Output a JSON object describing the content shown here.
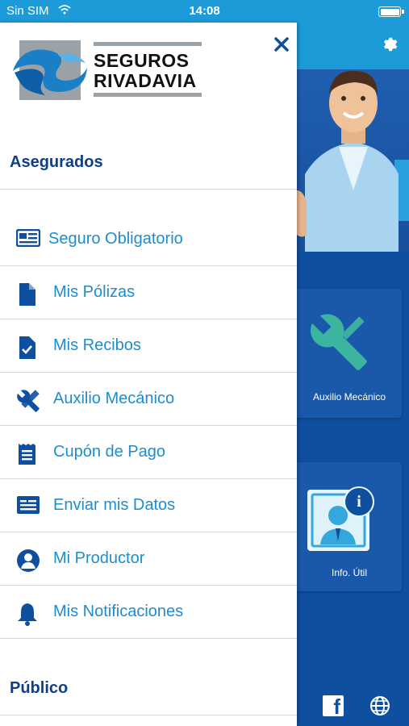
{
  "status_bar": {
    "carrier": "Sin SIM",
    "time": "14:08"
  },
  "logo": {
    "line1": "SEGUROS",
    "line2": "RIVADAVIA"
  },
  "drawer": {
    "section_insured": "Asegurados",
    "items": [
      {
        "label": "Seguro Obligatorio",
        "icon": "id-card-icon"
      },
      {
        "label": "Mis Pólizas",
        "icon": "document-icon"
      },
      {
        "label": "Mis Recibos",
        "icon": "receipt-check-icon"
      },
      {
        "label": "Auxilio Mecánico",
        "icon": "tools-icon"
      },
      {
        "label": "Cupón de Pago",
        "icon": "coupon-icon"
      },
      {
        "label": "Enviar mis Datos",
        "icon": "send-data-card-icon"
      },
      {
        "label": "Mi Productor",
        "icon": "person-icon"
      },
      {
        "label": "Mis Notificaciones",
        "icon": "bell-icon"
      }
    ],
    "section_public": "Público"
  },
  "background": {
    "tile_mechanic_label": "Auxilio Mecánico",
    "tile_info_label": "Info. Útil"
  },
  "colors": {
    "accent": "#1c8dd0",
    "navy": "#0f3f86",
    "status_bar": "#1d9ad8",
    "app_bg": "#0f4fa0"
  }
}
